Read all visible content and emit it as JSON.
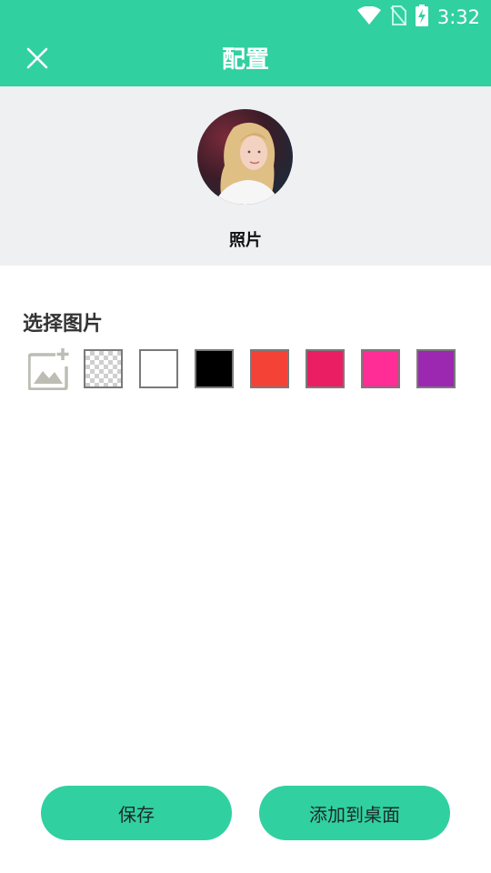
{
  "status_bar": {
    "time": "3:32",
    "icons": [
      "wifi-icon",
      "no-sim-icon",
      "battery-charging-icon"
    ]
  },
  "app_bar": {
    "title": "配置",
    "close_icon": "close-icon"
  },
  "preview": {
    "label": "照片"
  },
  "picker": {
    "title": "选择图片",
    "add_image_icon": "add-image-icon",
    "swatches": [
      {
        "name": "transparent",
        "color": "transparent"
      },
      {
        "name": "white",
        "color": "#ffffff"
      },
      {
        "name": "black",
        "color": "#000000"
      },
      {
        "name": "red",
        "color": "#f44336"
      },
      {
        "name": "crimson",
        "color": "#e91e63"
      },
      {
        "name": "pink",
        "color": "#ff2d95"
      },
      {
        "name": "purple",
        "color": "#9c27b0"
      }
    ]
  },
  "buttons": {
    "save": "保存",
    "add_to_desktop": "添加到桌面"
  },
  "colors": {
    "accent": "#31d0a1",
    "preview_bg": "#eef0f2"
  }
}
